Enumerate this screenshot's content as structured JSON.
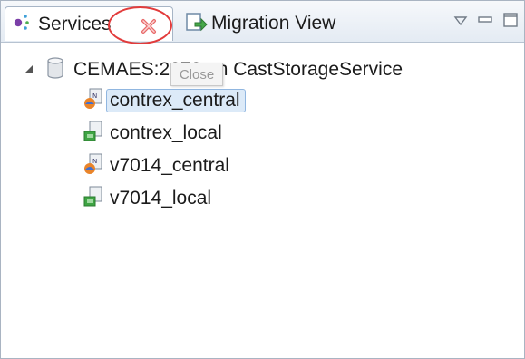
{
  "tabs": [
    {
      "label": "Services",
      "icon": "services-icon"
    },
    {
      "label": "Migration View",
      "icon": "migration-view-icon"
    }
  ],
  "tooltip": {
    "text": "Close"
  },
  "tree": {
    "root": {
      "label": "CEMAES:2278 on CastStorageService",
      "icon": "database-icon",
      "expanded": true
    },
    "children": [
      {
        "label": "contrex_central",
        "icon": "central-schema-icon",
        "selected": true
      },
      {
        "label": "contrex_local",
        "icon": "local-schema-icon",
        "selected": false
      },
      {
        "label": "v7014_central",
        "icon": "central-schema-icon",
        "selected": false
      },
      {
        "label": "v7014_local",
        "icon": "local-schema-icon",
        "selected": false
      }
    ]
  },
  "colors": {
    "annotation": "#e23b3b",
    "selection": "#dceaf8"
  }
}
